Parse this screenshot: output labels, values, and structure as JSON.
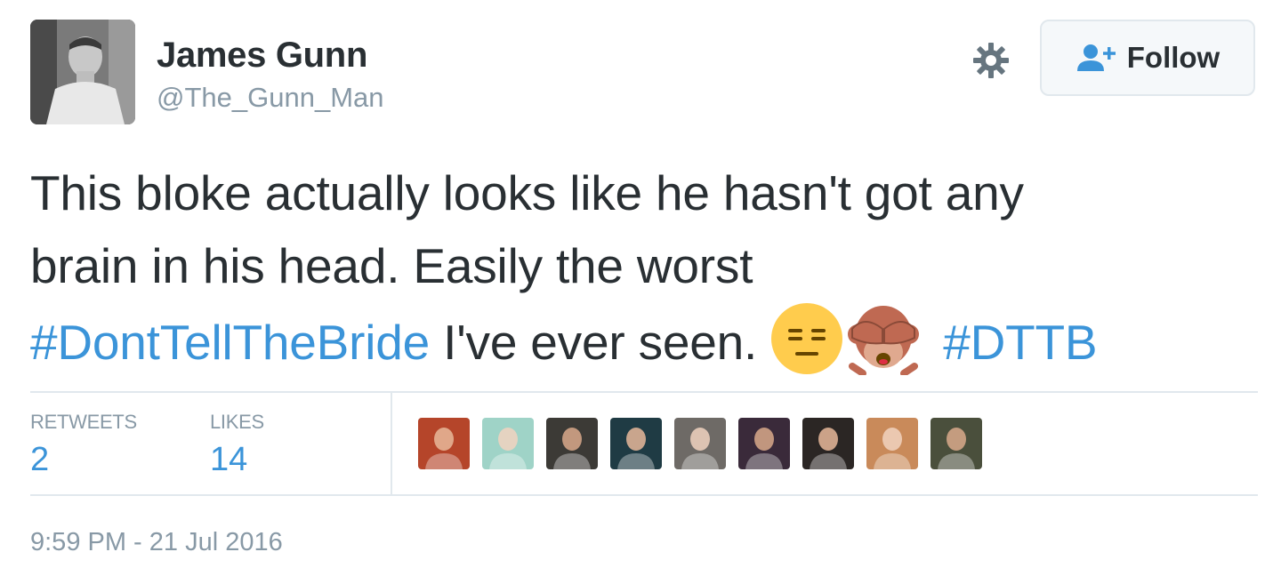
{
  "user": {
    "display_name": "James Gunn",
    "handle": "@The_Gunn_Man",
    "avatar_icon": "profile-photo"
  },
  "header": {
    "follow_label": "Follow",
    "settings_icon": "gear-icon",
    "follow_icon": "add-user-icon"
  },
  "tweet": {
    "line1": "This bloke actually looks like he hasn't got any",
    "line2": "brain in his head. Easily the worst",
    "hashtag1": "#DontTellTheBride",
    "line3_text": " I've ever seen. ",
    "hashtag2": "#DTTB",
    "emojis": [
      "expressionless-face-emoji",
      "see-no-evil-monkey-emoji"
    ]
  },
  "stats": {
    "retweets_label": "RETWEETS",
    "retweets_count": "2",
    "likes_label": "LIKES",
    "likes_count": "14"
  },
  "likers": [
    {
      "name": "liker-avatar-1",
      "color": "#b5452a"
    },
    {
      "name": "liker-avatar-2",
      "color": "#9fd3c7"
    },
    {
      "name": "liker-avatar-3",
      "color": "#3c3a36"
    },
    {
      "name": "liker-avatar-4",
      "color": "#1f3b44"
    },
    {
      "name": "liker-avatar-5",
      "color": "#6e6a66"
    },
    {
      "name": "liker-avatar-6",
      "color": "#3a2a3a"
    },
    {
      "name": "liker-avatar-7",
      "color": "#2b2624"
    },
    {
      "name": "liker-avatar-8",
      "color": "#c98a5a"
    },
    {
      "name": "liker-avatar-9",
      "color": "#4a4f3c"
    }
  ],
  "timestamp": "9:59 PM - 21 Jul 2016",
  "colors": {
    "link": "#3b94d9",
    "text": "#292f33",
    "muted": "#8899a6",
    "border": "#e1e8ed"
  }
}
